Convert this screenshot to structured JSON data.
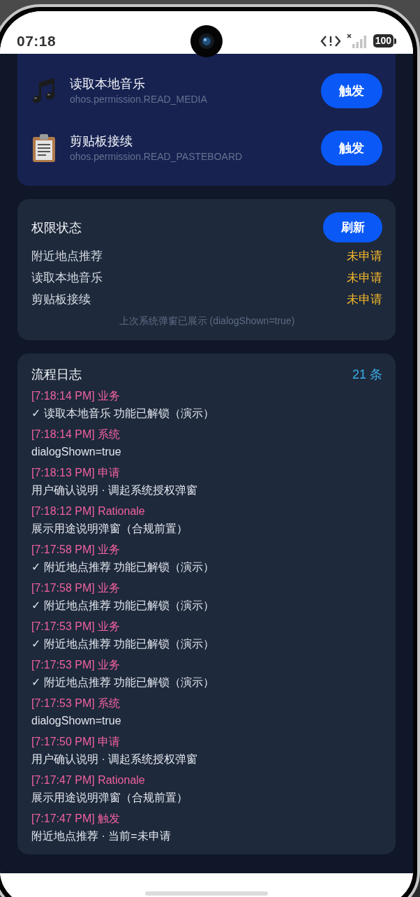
{
  "status_bar": {
    "time": "07:18",
    "battery": "100"
  },
  "feature_card": {
    "items": [
      {
        "kind": "music",
        "title": "读取本地音乐",
        "permission": "ohos.permission.READ_MEDIA",
        "button": "触发"
      },
      {
        "kind": "clipboard",
        "title": "剪贴板接续",
        "permission": "ohos.permission.READ_PASTEBOARD",
        "button": "触发"
      }
    ]
  },
  "status_card": {
    "title": "权限状态",
    "refresh_button": "刷新",
    "rows": [
      {
        "name": "附近地点推荐",
        "status": "未申请"
      },
      {
        "name": "读取本地音乐",
        "status": "未申请"
      },
      {
        "name": "剪贴板接续",
        "status": "未申请"
      }
    ],
    "footer": "上次系统弹窗已展示 (dialogShown=true)"
  },
  "log_card": {
    "title": "流程日志",
    "count": "21 条",
    "entries": [
      {
        "header": "[7:18:14 PM] 业务",
        "message": "✓ 读取本地音乐 功能已解锁（演示）"
      },
      {
        "header": "[7:18:14 PM] 系统",
        "message": "dialogShown=true"
      },
      {
        "header": "[7:18:13 PM] 申请",
        "message": "用户确认说明 · 调起系统授权弹窗"
      },
      {
        "header": "[7:18:12 PM] Rationale",
        "message": "展示用途说明弹窗（合规前置）"
      },
      {
        "header": "[7:17:58 PM] 业务",
        "message": "✓ 附近地点推荐 功能已解锁（演示）"
      },
      {
        "header": "[7:17:58 PM] 业务",
        "message": "✓ 附近地点推荐 功能已解锁（演示）"
      },
      {
        "header": "[7:17:53 PM] 业务",
        "message": "✓ 附近地点推荐 功能已解锁（演示）"
      },
      {
        "header": "[7:17:53 PM] 业务",
        "message": "✓ 附近地点推荐 功能已解锁（演示）"
      },
      {
        "header": "[7:17:53 PM] 系统",
        "message": "dialogShown=true"
      },
      {
        "header": "[7:17:50 PM] 申请",
        "message": "用户确认说明 · 调起系统授权弹窗"
      },
      {
        "header": "[7:17:47 PM] Rationale",
        "message": "展示用途说明弹窗（合规前置）"
      },
      {
        "header": "[7:17:47 PM] 触发",
        "message": "附近地点推荐 · 当前=未申请"
      }
    ]
  }
}
